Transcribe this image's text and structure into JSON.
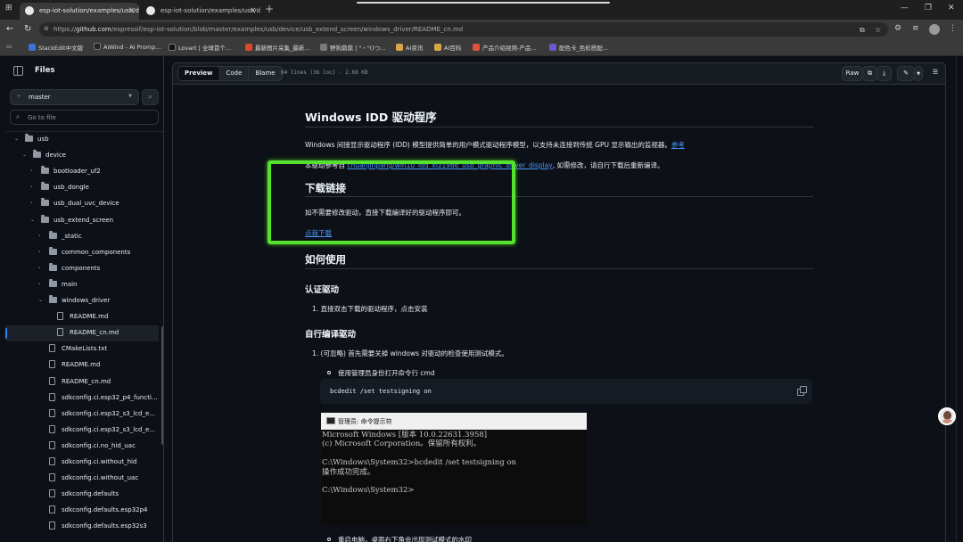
{
  "browser": {
    "tabs": [
      {
        "title": "esp-iot-solution/examples/usb/dev",
        "active": true
      },
      {
        "title": "esp-iot-solution/examples/usb/dev",
        "active": false
      }
    ],
    "url_prefix": "https://",
    "url_host": "github.com",
    "url_path": "/espressif/esp-iot-solution/blob/master/examples/usb/device/usb_extend_screen/windows_driver/README_cn.md",
    "bookmarks": [
      {
        "label": "StackEdit中文版",
        "color": "#3b73d8"
      },
      {
        "label": "AiWind - AI Promp...",
        "color": "#222222"
      },
      {
        "label": "Lovart | 全球首个...",
        "color": "#111111"
      },
      {
        "label": "最新图片采集_最新...",
        "color": "#d84a2b"
      },
      {
        "label": "野狗鼎鼎 | \"・\"()つ...",
        "color": "#7a7a7a"
      },
      {
        "label": "AI资讯",
        "color": "#d9a64a"
      },
      {
        "label": "AI百科",
        "color": "#d9a64a"
      },
      {
        "label": "产品介绍视频-产品...",
        "color": "#e0523d"
      },
      {
        "label": "配色卡_色彩搭配...",
        "color": "#6a5acd"
      }
    ]
  },
  "sidebar": {
    "title": "Files",
    "branch": "master",
    "goto_placeholder": "Go to file",
    "tree": [
      {
        "label": "usb",
        "type": "folder",
        "depth": 0,
        "open": true
      },
      {
        "label": "device",
        "type": "folder",
        "depth": 1,
        "open": true
      },
      {
        "label": "bootloader_uf2",
        "type": "folder",
        "depth": 2,
        "open": false
      },
      {
        "label": "usb_dongle",
        "type": "folder",
        "depth": 2,
        "open": false
      },
      {
        "label": "usb_dual_uvc_device",
        "type": "folder",
        "depth": 2,
        "open": false
      },
      {
        "label": "usb_extend_screen",
        "type": "folder",
        "depth": 2,
        "open": true
      },
      {
        "label": "_static",
        "type": "folder",
        "depth": 3,
        "open": false
      },
      {
        "label": "common_components",
        "type": "folder",
        "depth": 3,
        "open": false
      },
      {
        "label": "components",
        "type": "folder",
        "depth": 3,
        "open": false
      },
      {
        "label": "main",
        "type": "folder",
        "depth": 3,
        "open": false
      },
      {
        "label": "windows_driver",
        "type": "folder",
        "depth": 3,
        "open": true
      },
      {
        "label": "README.md",
        "type": "file",
        "depth": 4
      },
      {
        "label": "README_cn.md",
        "type": "file",
        "depth": 4,
        "selected": true
      },
      {
        "label": "CMakeLists.txt",
        "type": "file",
        "depth": 3
      },
      {
        "label": "README.md",
        "type": "file",
        "depth": 3
      },
      {
        "label": "README_cn.md",
        "type": "file",
        "depth": 3
      },
      {
        "label": "sdkconfig.ci.esp32_p4_functi...",
        "type": "file",
        "depth": 3
      },
      {
        "label": "sdkconfig.ci.esp32_s3_lcd_e...",
        "type": "file",
        "depth": 3
      },
      {
        "label": "sdkconfig.ci.esp32_s3_lcd_e...",
        "type": "file",
        "depth": 3
      },
      {
        "label": "sdkconfig.ci.no_hid_uac",
        "type": "file",
        "depth": 3
      },
      {
        "label": "sdkconfig.ci.without_hid",
        "type": "file",
        "depth": 3
      },
      {
        "label": "sdkconfig.ci.without_uac",
        "type": "file",
        "depth": 3
      },
      {
        "label": "sdkconfig.defaults",
        "type": "file",
        "depth": 3
      },
      {
        "label": "sdkconfig.defaults.esp32p4",
        "type": "file",
        "depth": 3
      },
      {
        "label": "sdkconfig.defaults.esp32s3",
        "type": "file",
        "depth": 3
      }
    ]
  },
  "file_header": {
    "tabs": [
      "Preview",
      "Code",
      "Blame"
    ],
    "active_tab": "Preview",
    "info": "64 lines (36 loc) · 2.68 KB",
    "raw_label": "Raw"
  },
  "readme": {
    "title": "Windows IDD 驱动程序",
    "intro": "Windows 间接显示驱动程序 (IDD) 模型提供简单的用户模式驱动程序模型，以支持未连接到传统 GPU 显示输出的监视器。",
    "intro_link": "参考",
    "ref_prefix": "本驱动参考自 ",
    "ref_link": "chuanjinpang/win10_idd_xfz1986_usb_graphic_driver_display",
    "ref_suffix": ", 如需修改，请自行下载后重新编译。",
    "download_heading": "下载链接",
    "download_text": "如不需要修改驱动，直接下载编译好的驱动程序即可。",
    "download_link": "点我下载",
    "usage_heading": "如何使用",
    "cert_heading": "认证驱动",
    "cert_step": "直接双击下载的驱动程序，点击安装",
    "build_heading": "自行编译驱动",
    "build_step": "(可忽略) 首先需要关掉 windows 对驱动的检查使用测试模式。",
    "build_sub": "使用管理员身份打开命令行 cmd",
    "code": "bcdedit /set testsigning on",
    "cmd_title": "管理员: 命令提示符",
    "cmd_output": "Microsoft Windows [版本 10.0.22631.3958]\n(c) Microsoft Corporation。保留所有权利。\n\nC:\\Windows\\System32>bcdedit /set testsigning on\n操作成功完成。\n\nC:\\Windows\\System32>",
    "reboot_step": "重启电脑，桌面右下角会出现测试模式的水印"
  }
}
